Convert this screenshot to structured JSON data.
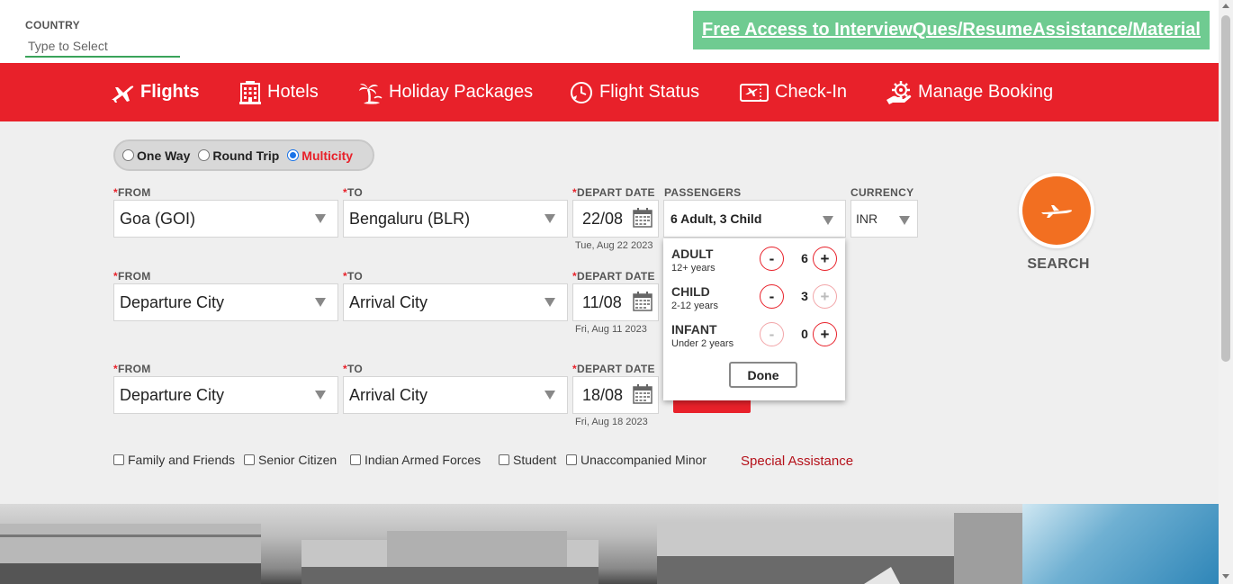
{
  "header": {
    "country_label": "COUNTRY",
    "country_placeholder": "Type to Select",
    "promo_link": "Free Access to InterviewQues/ResumeAssistance/Material"
  },
  "nav": {
    "items": [
      {
        "label": "Flights",
        "icon": "airplane-icon",
        "active": true
      },
      {
        "label": "Hotels",
        "icon": "hotel-building-icon",
        "active": false
      },
      {
        "label": "Holiday Packages",
        "icon": "palm-tree-icon",
        "active": false
      },
      {
        "label": "Flight Status",
        "icon": "clock-plane-icon",
        "active": false
      },
      {
        "label": "Check-In",
        "icon": "boarding-pass-icon",
        "active": false
      },
      {
        "label": "Manage Booking",
        "icon": "gear-hand-icon",
        "active": false
      }
    ]
  },
  "trip_type": {
    "options": [
      "One Way",
      "Round Trip",
      "Multicity"
    ],
    "selected": "Multicity"
  },
  "labels": {
    "from": "FROM",
    "to": "TO",
    "depart_date": "DEPART DATE",
    "passengers": "PASSENGERS",
    "currency": "CURRENCY",
    "required_mark": "*"
  },
  "legs": [
    {
      "from": "Goa (GOI)",
      "to": "Bengaluru (BLR)",
      "date": "22/08",
      "date_full": "Tue, Aug 22 2023"
    },
    {
      "from": "Departure City",
      "to": "Arrival City",
      "date": "11/08",
      "date_full": "Fri, Aug 11 2023"
    },
    {
      "from": "Departure City",
      "to": "Arrival City",
      "date": "18/08",
      "date_full": "Fri, Aug 18 2023"
    }
  ],
  "passengers": {
    "summary": "6 Adult, 3 Child",
    "rows": [
      {
        "name": "ADULT",
        "age": "12+ years",
        "count": "6",
        "minus": "-",
        "plus": "+"
      },
      {
        "name": "CHILD",
        "age": "2-12 years",
        "count": "3",
        "minus": "-",
        "plus": "+"
      },
      {
        "name": "INFANT",
        "age": "Under 2 years",
        "count": "0",
        "minus": "-",
        "plus": "+"
      }
    ],
    "done_label": "Done"
  },
  "currency": {
    "value": "INR"
  },
  "search": {
    "label": "SEARCH"
  },
  "concessions": {
    "options": [
      "Family and Friends",
      "Senior Citizen",
      "Indian Armed Forces",
      "Student",
      "Unaccompanied Minor"
    ],
    "special_link": "Special Assistance"
  },
  "colors": {
    "brand_red": "#e8212a",
    "search_orange": "#f26f21",
    "promo_green": "#6fcb91",
    "link_red": "#b5121b"
  }
}
